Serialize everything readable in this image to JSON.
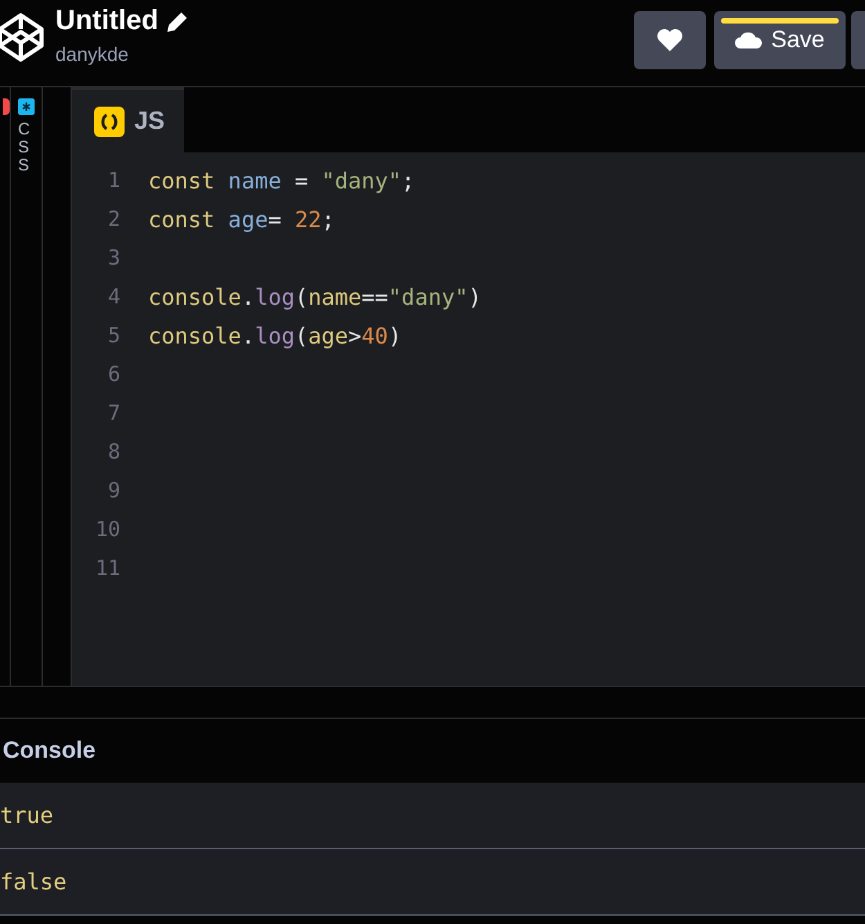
{
  "header": {
    "title": "Untitled",
    "author": "danykde",
    "save_label": "Save"
  },
  "side_tabs": [
    {
      "label": "CSS"
    }
  ],
  "editor": {
    "tab": "JS",
    "lines": [
      {
        "number": "1",
        "tokens": [
          {
            "kind": "keyword",
            "text": "const"
          },
          {
            "kind": "variable",
            "text": " name"
          },
          {
            "kind": "plain",
            "text": " = "
          },
          {
            "kind": "string",
            "text": "\"dany\""
          },
          {
            "kind": "plain",
            "text": ";"
          }
        ]
      },
      {
        "number": "2",
        "tokens": [
          {
            "kind": "keyword",
            "text": "const"
          },
          {
            "kind": "variable",
            "text": " age"
          },
          {
            "kind": "plain",
            "text": "= "
          },
          {
            "kind": "number",
            "text": "22"
          },
          {
            "kind": "plain",
            "text": ";"
          }
        ]
      },
      {
        "number": "3"
      },
      {
        "number": "4",
        "tokens": [
          {
            "kind": "keyword",
            "text": "console"
          },
          {
            "kind": "plain",
            "text": "."
          },
          {
            "kind": "function",
            "text": "log"
          },
          {
            "kind": "plain",
            "text": "("
          },
          {
            "kind": "keyword",
            "text": "name"
          },
          {
            "kind": "plain",
            "text": "=="
          },
          {
            "kind": "string",
            "text": "\"dany\""
          },
          {
            "kind": "plain",
            "text": ")"
          }
        ]
      },
      {
        "number": "5",
        "tokens": [
          {
            "kind": "keyword",
            "text": "console"
          },
          {
            "kind": "plain",
            "text": "."
          },
          {
            "kind": "function",
            "text": "log"
          },
          {
            "kind": "plain",
            "text": "("
          },
          {
            "kind": "keyword",
            "text": "age"
          },
          {
            "kind": "plain",
            "text": ">"
          },
          {
            "kind": "number",
            "text": "40"
          },
          {
            "kind": "plain",
            "text": ")"
          }
        ]
      },
      {
        "number": "6"
      },
      {
        "number": "7"
      },
      {
        "number": "8"
      },
      {
        "number": "9"
      },
      {
        "number": "10"
      },
      {
        "number": "11"
      }
    ]
  },
  "console": {
    "title": "Console",
    "lines": [
      "true",
      "false"
    ]
  }
}
